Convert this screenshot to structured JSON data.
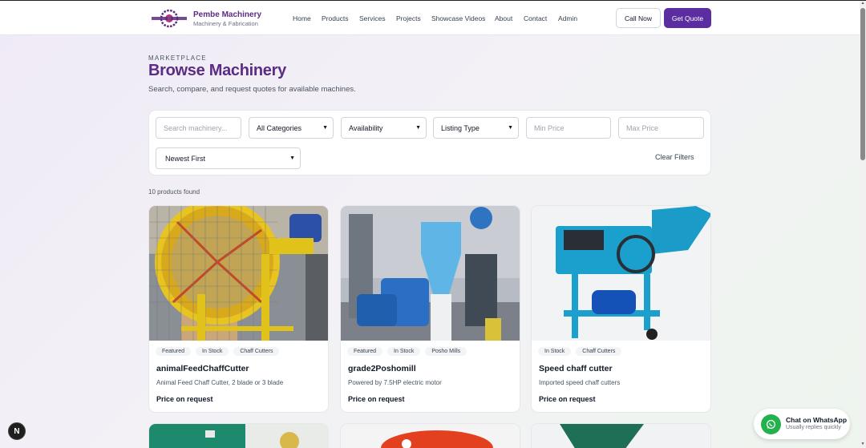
{
  "header": {
    "brand_name": "Pembe Machinery",
    "brand_sub": "Machinery & Fabrication",
    "nav": [
      "Home",
      "Products",
      "Services",
      "Projects",
      "Showcase Videos",
      "About",
      "Contact",
      "Admin"
    ],
    "call_label": "Call Now",
    "quote_label": "Get Quote"
  },
  "hero": {
    "eyebrow": "MARKETPLACE",
    "title": "Browse Machinery",
    "subtitle": "Search, compare, and request quotes for available machines."
  },
  "filters": {
    "search_placeholder": "Search machinery...",
    "category": "All Categories",
    "availability": "Availability",
    "listing_type": "Listing Type",
    "min_price_placeholder": "Min Price",
    "max_price_placeholder": "Max Price",
    "sort": "Newest First",
    "clear_label": "Clear Filters"
  },
  "results": {
    "count_text": "10 products found"
  },
  "products": [
    {
      "tags": [
        "Featured",
        "In Stock",
        "Chaff Cutters"
      ],
      "title": "animalFeedChaffCutter",
      "description": "Animal Feed Chaff Cutter, 2 blade or 3 blade",
      "price": "Price on request"
    },
    {
      "tags": [
        "Featured",
        "In Stock",
        "Posho Mills"
      ],
      "title": "grade2Poshomill",
      "description": "Powered by 7.5HP electric motor",
      "price": "Price on request"
    },
    {
      "tags": [
        "In Stock",
        "Chaff Cutters"
      ],
      "title": "Speed chaff cutter",
      "description": "Imported speed chaff cutters",
      "price": "Price on request"
    }
  ],
  "whatsapp": {
    "title": "Chat on WhatsApp",
    "sub": "Usually replies quickly"
  },
  "badge": {
    "letter": "N"
  },
  "colors": {
    "brand": "#5b2c83",
    "accent": "#5b2da0",
    "whatsapp": "#22b14c"
  }
}
